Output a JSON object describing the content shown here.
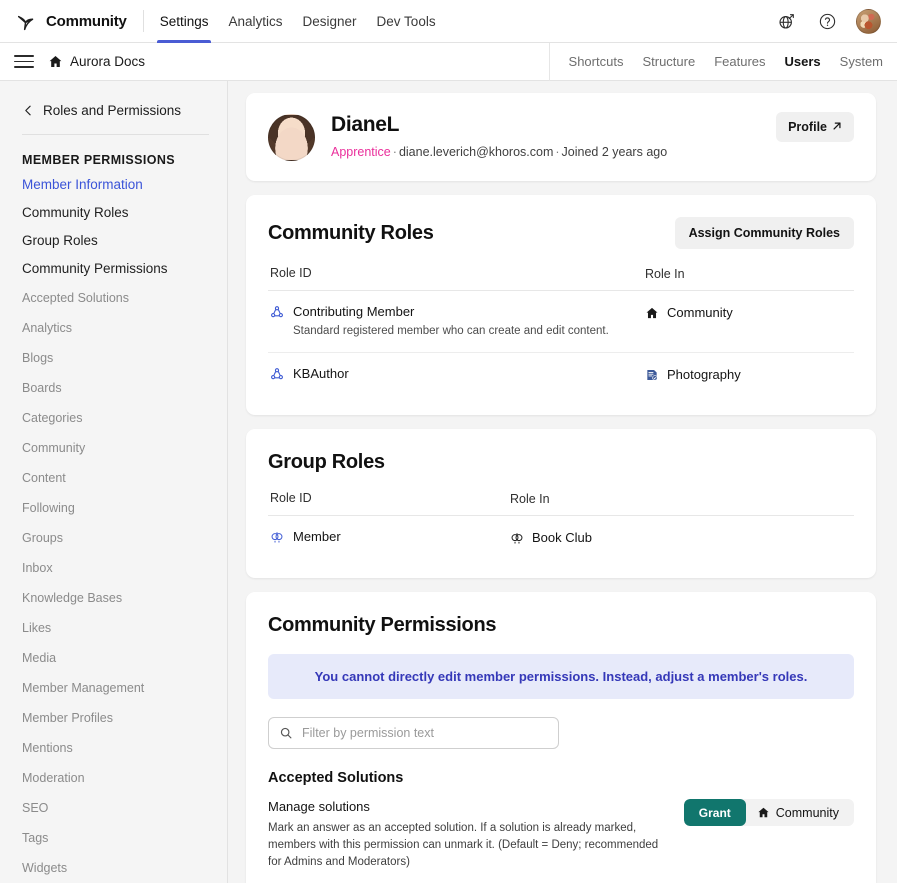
{
  "topbar": {
    "logo_icon": "khoros-logo-icon",
    "brand": "Community",
    "tabs": [
      {
        "label": "Settings",
        "active": true
      },
      {
        "label": "Analytics",
        "active": false
      },
      {
        "label": "Designer",
        "active": false
      },
      {
        "label": "Dev Tools",
        "active": false
      }
    ],
    "actions": [
      {
        "icon": "globe-external-link-icon",
        "name": "visit-site-button"
      },
      {
        "icon": "help-circle-icon",
        "name": "help-button"
      },
      {
        "icon": "user-avatar",
        "name": "account-avatar"
      }
    ]
  },
  "subbar": {
    "menu_icon": "hamburger-menu-icon",
    "home_icon": "home-icon",
    "breadcrumb": "Aurora Docs",
    "tabs": [
      {
        "label": "Shortcuts",
        "active": false
      },
      {
        "label": "Structure",
        "active": false
      },
      {
        "label": "Features",
        "active": false
      },
      {
        "label": "Users",
        "active": true
      },
      {
        "label": "System",
        "active": false
      }
    ]
  },
  "sidebar": {
    "back_label": "Roles and Permissions",
    "back_icon": "chevron-left-icon",
    "section_heading": "MEMBER PERMISSIONS",
    "primary_items": [
      {
        "label": "Member Information",
        "active": true
      },
      {
        "label": "Community Roles",
        "active": false
      },
      {
        "label": "Group Roles",
        "active": false
      },
      {
        "label": "Community Permissions",
        "active": false
      }
    ],
    "secondary_items": [
      {
        "label": "Accepted Solutions"
      },
      {
        "label": "Analytics"
      },
      {
        "label": "Blogs"
      },
      {
        "label": "Boards"
      },
      {
        "label": "Categories"
      },
      {
        "label": "Community"
      },
      {
        "label": "Content"
      },
      {
        "label": "Following"
      },
      {
        "label": "Groups"
      },
      {
        "label": "Inbox"
      },
      {
        "label": "Knowledge Bases"
      },
      {
        "label": "Likes"
      },
      {
        "label": "Media"
      },
      {
        "label": "Member Management"
      },
      {
        "label": "Member Profiles"
      },
      {
        "label": "Mentions"
      },
      {
        "label": "Moderation"
      },
      {
        "label": "SEO"
      },
      {
        "label": "Tags"
      },
      {
        "label": "Widgets"
      }
    ]
  },
  "profile": {
    "avatar": "member-avatar",
    "name": "DianeL",
    "rank": "Apprentice",
    "email": "diane.leverich@khoros.com",
    "joined": "Joined 2 years ago",
    "separator": "·",
    "button_label": "Profile",
    "button_icon": "external-link-arrow-icon"
  },
  "community_roles": {
    "title": "Community Roles",
    "button_label": "Assign Community Roles",
    "columns": {
      "role_id": "Role ID",
      "role_in": "Role In"
    },
    "rows": [
      {
        "role_icon": "role-group-icon",
        "role": "Contributing Member",
        "description": "Standard registered member who can create and edit content.",
        "scope_icon": "home-icon",
        "scope": "Community"
      },
      {
        "role_icon": "role-group-icon",
        "role": "KBAuthor",
        "description": "",
        "scope_icon": "knowledge-base-icon",
        "scope": "Photography"
      }
    ]
  },
  "group_roles": {
    "title": "Group Roles",
    "columns": {
      "role_id": "Role ID",
      "role_in": "Role In"
    },
    "rows": [
      {
        "role_icon": "group-members-icon",
        "role": "Member",
        "scope_icon": "group-members-icon",
        "scope": "Book Club"
      }
    ]
  },
  "community_permissions": {
    "title": "Community Permissions",
    "banner": "You cannot directly edit member permissions. Instead, adjust a member's roles.",
    "filter_placeholder": "Filter by permission text",
    "filter_value": "",
    "filter_icon": "search-icon",
    "group_title": "Accepted Solutions",
    "permissions": [
      {
        "name": "Manage solutions",
        "description": "Mark an answer as an accepted solution. If a solution is already marked, members with this permission can unmark it. (Default = Deny; recommended for Admins and Moderators)",
        "state_label": "Grant",
        "scope_icon": "home-icon",
        "scope": "Community"
      }
    ]
  },
  "colors": {
    "accent_blue": "#3b54d8",
    "tab_underline": "#4a5cd4",
    "rank_pink": "#ea2f9b",
    "banner_bg": "#e7eafa",
    "banner_text": "#3538b8",
    "grant_teal": "#11766d",
    "sidebar_bg": "#f5f5f5",
    "page_bg": "#f4f4f4",
    "role_icon_blue": "#3f5bd4"
  }
}
